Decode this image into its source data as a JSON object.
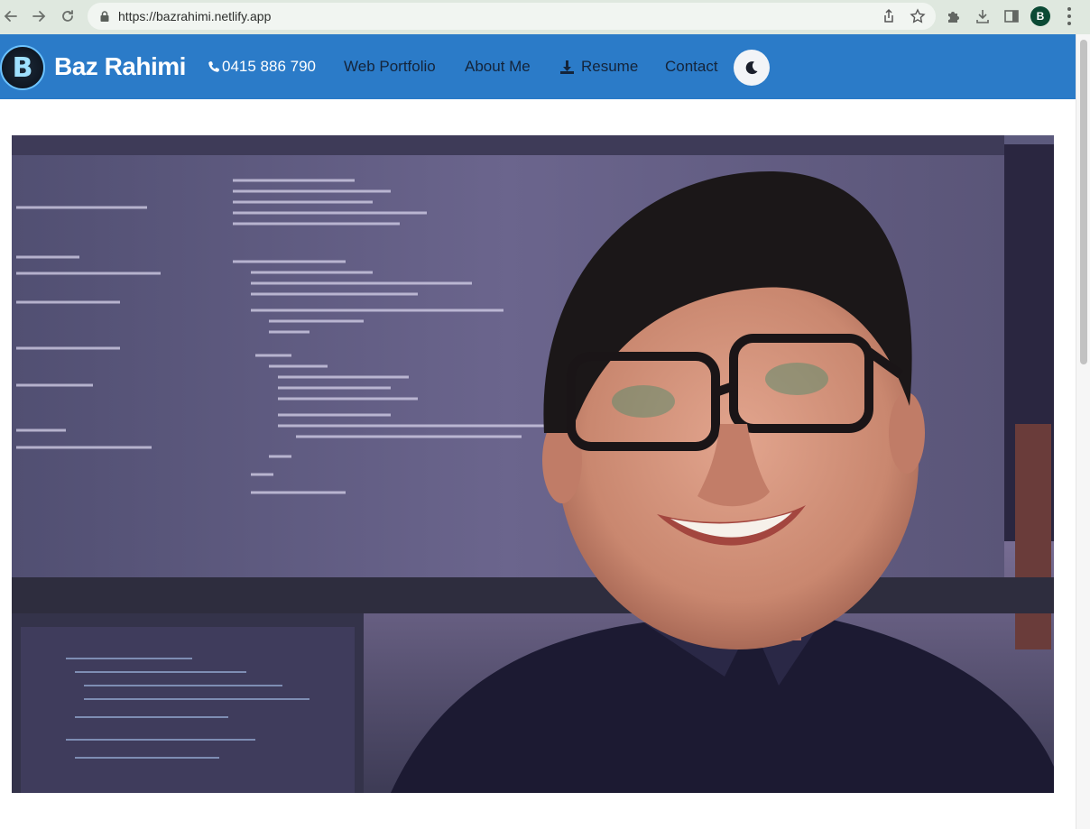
{
  "browser": {
    "url": "https://bazrahimi.netlify.app",
    "profile_initial": "B"
  },
  "header": {
    "brand": "Baz Rahimi",
    "logo_letter": "B",
    "nav": {
      "phone": "0415 886 790",
      "portfolio": "Web Portfolio",
      "about": "About Me",
      "resume": "Resume",
      "contact": "Contact"
    },
    "icons": {
      "phone": "phone-icon",
      "resume": "download-icon",
      "theme": "moon-icon"
    }
  },
  "colors": {
    "header_bg": "#2b7bc8",
    "browser_bar": "#dfe8df",
    "nav_text": "#14243a"
  },
  "hero": {
    "image_subject": "portrait-photo"
  }
}
